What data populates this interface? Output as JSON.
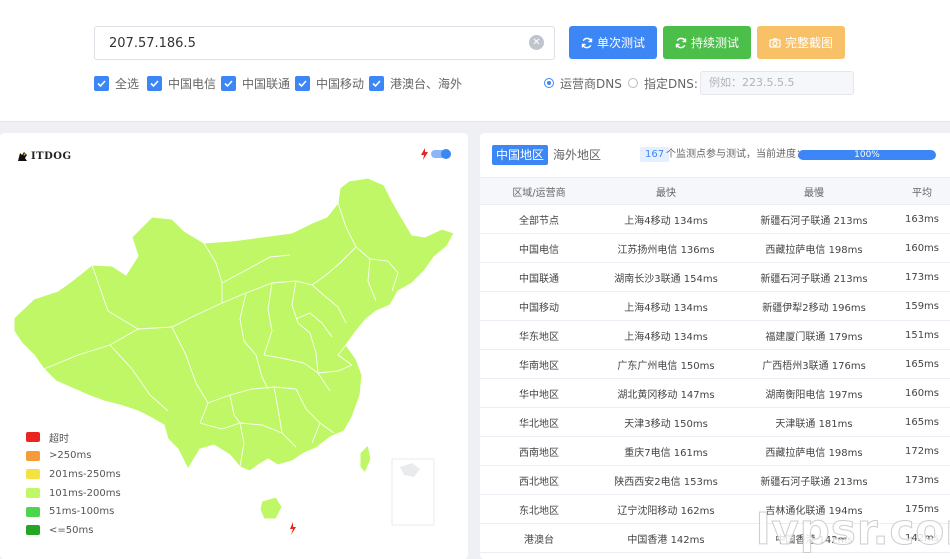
{
  "search": {
    "value": "207.57.186.5",
    "clear_icon": "clear-icon"
  },
  "buttons": {
    "single": "单次测试",
    "continuous": "持续测试",
    "screenshot": "完整截图"
  },
  "filters": [
    {
      "label": "全选",
      "checked": true
    },
    {
      "label": "中国电信",
      "checked": true
    },
    {
      "label": "中国联通",
      "checked": true
    },
    {
      "label": "中国移动",
      "checked": true
    },
    {
      "label": "港澳台、海外",
      "checked": true
    }
  ],
  "dns": {
    "carrier_label": "运营商DNS",
    "custom_label": "指定DNS:",
    "placeholder": "例如：223.5.5.5",
    "selected": "carrier"
  },
  "map": {
    "logo": "ITDOG",
    "fill_color": "#c0f766",
    "legend": [
      {
        "label": "超时",
        "color": "#e8251f"
      },
      {
        "label": ">250ms",
        "color": "#f59b38"
      },
      {
        "label": "201ms-250ms",
        "color": "#f3e23f"
      },
      {
        "label": "101ms-200ms",
        "color": "#c0f766"
      },
      {
        "label": "51ms-100ms",
        "color": "#4bd64b"
      },
      {
        "label": "<=50ms",
        "color": "#23a623"
      }
    ]
  },
  "results": {
    "tab_china": "中国地区",
    "tab_overseas": "海外地区",
    "node_count": "167",
    "node_text": "个监测点参与测试，当前进度：",
    "progress": "100%",
    "headers": [
      "区域/运营商",
      "最快",
      "最慢",
      "平均"
    ],
    "rows": [
      [
        "全部节点",
        "上海4移动 134ms",
        "新疆石河子联通 213ms",
        "163ms"
      ],
      [
        "中国电信",
        "江苏扬州电信 136ms",
        "西藏拉萨电信 198ms",
        "160ms"
      ],
      [
        "中国联通",
        "湖南长沙3联通 154ms",
        "新疆石河子联通 213ms",
        "173ms"
      ],
      [
        "中国移动",
        "上海4移动 134ms",
        "新疆伊犁2移动 196ms",
        "159ms"
      ],
      [
        "华东地区",
        "上海4移动 134ms",
        "福建厦门联通 179ms",
        "151ms"
      ],
      [
        "华南地区",
        "广东广州电信 150ms",
        "广西梧州3联通 176ms",
        "165ms"
      ],
      [
        "华中地区",
        "湖北黄冈移动 147ms",
        "湖南衡阳电信 197ms",
        "160ms"
      ],
      [
        "华北地区",
        "天津3移动 150ms",
        "天津联通 181ms",
        "165ms"
      ],
      [
        "西南地区",
        "重庆7电信 161ms",
        "西藏拉萨电信 198ms",
        "172ms"
      ],
      [
        "西北地区",
        "陕西西安2电信 153ms",
        "新疆石河子联通 213ms",
        "173ms"
      ],
      [
        "东北地区",
        "辽宁沈阳移动 162ms",
        "吉林通化联通 194ms",
        "175ms"
      ],
      [
        "港澳台",
        "中国香港 142ms",
        "中国香港 142ms",
        "142ms"
      ]
    ]
  },
  "watermark": "lvpsr.com"
}
